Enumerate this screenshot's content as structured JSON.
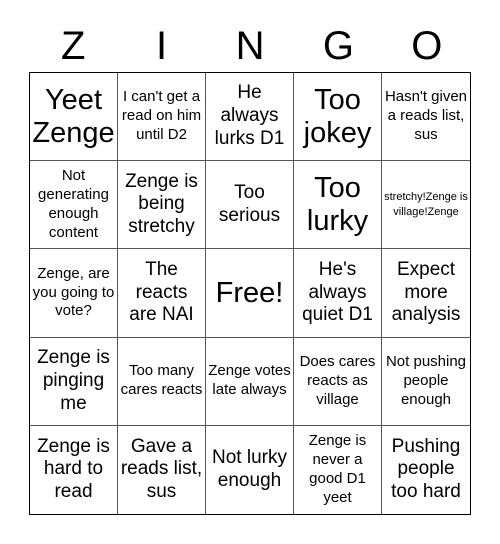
{
  "header": {
    "letters": [
      "Z",
      "I",
      "N",
      "G",
      "O"
    ]
  },
  "board": {
    "cells": [
      {
        "text": "Yeet Zenge",
        "size": "xl"
      },
      {
        "text": "I can't get a read on him until D2",
        "size": "s"
      },
      {
        "text": "He always lurks D1",
        "size": "m"
      },
      {
        "text": "Too jokey",
        "size": "xl"
      },
      {
        "text": "Hasn't given a reads list, sus",
        "size": "s"
      },
      {
        "text": "Not generating enough content",
        "size": "s"
      },
      {
        "text": "Zenge is being stretchy",
        "size": "m"
      },
      {
        "text": "Too serious",
        "size": "m"
      },
      {
        "text": "Too lurky",
        "size": "xl"
      },
      {
        "text": "stretchy!Zenge is village!Zenge",
        "size": "xs"
      },
      {
        "text": "Zenge, are you going to vote?",
        "size": "s"
      },
      {
        "text": "The reacts are NAI",
        "size": "m"
      },
      {
        "text": "Free!",
        "size": "xl"
      },
      {
        "text": "He's always quiet D1",
        "size": "m"
      },
      {
        "text": "Expect more analysis",
        "size": "m"
      },
      {
        "text": "Zenge is pinging me",
        "size": "m"
      },
      {
        "text": "Too many cares reacts",
        "size": "s"
      },
      {
        "text": "Zenge votes late always",
        "size": "s"
      },
      {
        "text": "Does cares reacts as village",
        "size": "s"
      },
      {
        "text": "Not pushing people enough",
        "size": "s"
      },
      {
        "text": "Zenge is hard to read",
        "size": "m"
      },
      {
        "text": "Gave a reads list, sus",
        "size": "m"
      },
      {
        "text": "Not lurky enough",
        "size": "m"
      },
      {
        "text": "Zenge is never a good D1 yeet",
        "size": "s"
      },
      {
        "text": "Pushing people too hard",
        "size": "m"
      }
    ]
  }
}
